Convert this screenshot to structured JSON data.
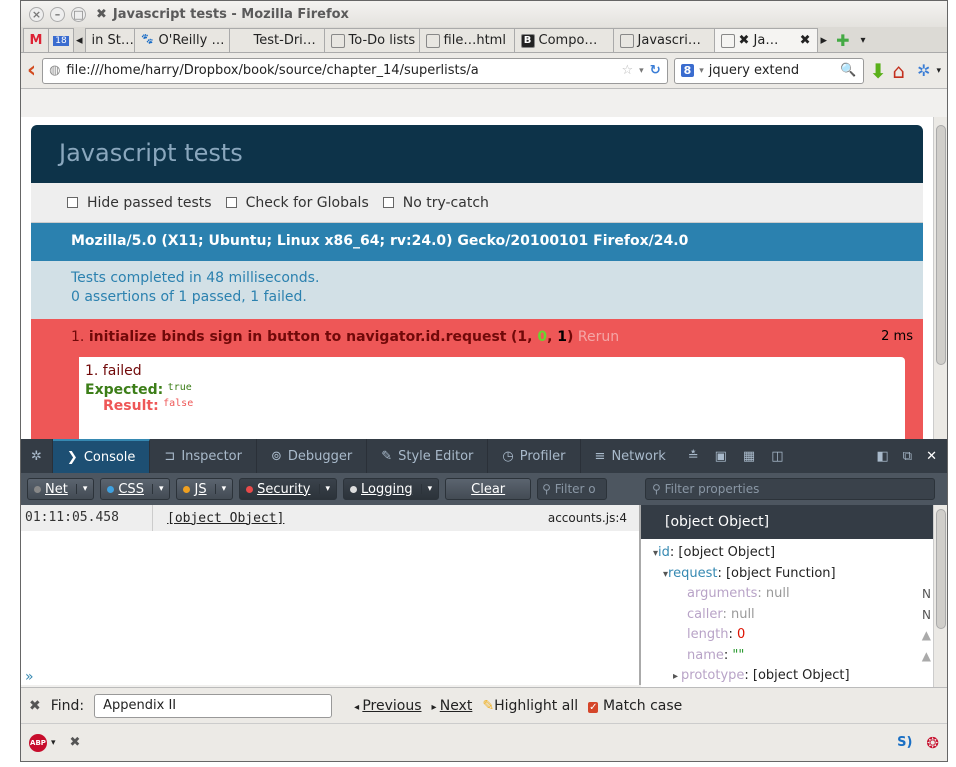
{
  "window": {
    "title": "Javascript tests - Mozilla Firefox",
    "title_icon": "✖"
  },
  "tabs": [
    {
      "label": "in St…",
      "icon": "tab-icon"
    },
    {
      "label": "O'Reilly …",
      "icon": "oreilly-icon"
    },
    {
      "label": "Test-Dri…",
      "icon": "page-icon"
    },
    {
      "label": "To-Do lists",
      "icon": "page-icon"
    },
    {
      "label": "file…html",
      "icon": "page-icon"
    },
    {
      "label": "Compo…",
      "icon": "bootstrap-icon"
    },
    {
      "label": "Javascri…",
      "icon": "page-icon"
    },
    {
      "label": "✖ Ja…",
      "icon": "page-icon"
    }
  ],
  "nav": {
    "url": "file:///home/harry/Dropbox/book/source/chapter_14/superlists/a",
    "search_value": "jquery extend"
  },
  "qunit": {
    "header": "Javascript tests",
    "options": [
      "Hide passed tests",
      "Check for Globals",
      "No try-catch"
    ],
    "user_agent": "Mozilla/5.0 (X11; Ubuntu; Linux x86_64; rv:24.0) Gecko/20100101 Firefox/24.0",
    "result_line1": "Tests completed in 48 milliseconds.",
    "result_line2": "0 assertions of 1 passed, 1 failed.",
    "test": {
      "number": "1.",
      "name": "initialize binds sign in button to navigator.id.request",
      "counts_open": "(",
      "failed": "1",
      "passed": "0",
      "total": "1",
      "counts_close": ")",
      "comma": ", ",
      "rerun": "Rerun",
      "duration": "2 ms"
    },
    "assertion": {
      "title": "1. failed",
      "expected_label": "Expected:",
      "expected_value": "true",
      "result_label": "Result:",
      "result_value": "false"
    }
  },
  "devtools": {
    "tabs": [
      "Console",
      "Inspector",
      "Debugger",
      "Style Editor",
      "Profiler",
      "Network"
    ],
    "filters": [
      {
        "label": "Net",
        "dot": ""
      },
      {
        "label": "CSS",
        "dot": "#3fa1e0"
      },
      {
        "label": "JS",
        "dot": "#f0a020"
      },
      {
        "label": "Security",
        "dot": "#e84a4a"
      },
      {
        "label": "Logging",
        "dot": "#dddddd"
      }
    ],
    "clear_label": "Clear",
    "filter_placeholder": "Filter o",
    "log": {
      "time": "01:11:05.458",
      "message": "[object Object]",
      "source": "accounts.js:4"
    },
    "prompt": "»",
    "variables": {
      "filter_placeholder": "Filter properties",
      "title": "[object Object]",
      "rows": [
        {
          "indent": 0,
          "arrow": "▾",
          "name": "id",
          "sep": ": ",
          "value": "[object Object]",
          "style": "key",
          "flag": ""
        },
        {
          "indent": 1,
          "arrow": "▾",
          "name": "request",
          "sep": ": ",
          "value": "[object Function]",
          "style": "key",
          "flag": ""
        },
        {
          "indent": 2,
          "arrow": "",
          "name": "arguments",
          "sep": ": ",
          "value": "null",
          "style": "dim",
          "flag": "N"
        },
        {
          "indent": 2,
          "arrow": "",
          "name": "caller",
          "sep": ": ",
          "value": "null",
          "style": "dim",
          "flag": "N"
        },
        {
          "indent": 2,
          "arrow": "",
          "name": "length",
          "sep": ": ",
          "value": "0",
          "style": "num",
          "flag": "🔒"
        },
        {
          "indent": 2,
          "arrow": "",
          "name": "name",
          "sep": ": ",
          "value": "\"\"",
          "style": "str",
          "flag": "🔒"
        },
        {
          "indent": 1,
          "arrow": "▸",
          "name": "prototype",
          "sep": ": ",
          "value": "[object Object]",
          "style": "key",
          "flag": ""
        }
      ]
    }
  },
  "findbar": {
    "close": "✖",
    "label": "Find:",
    "value": "Appendix II",
    "previous": "Previous",
    "next": "Next",
    "highlight": "Highlight all",
    "match_case": "Match case"
  }
}
